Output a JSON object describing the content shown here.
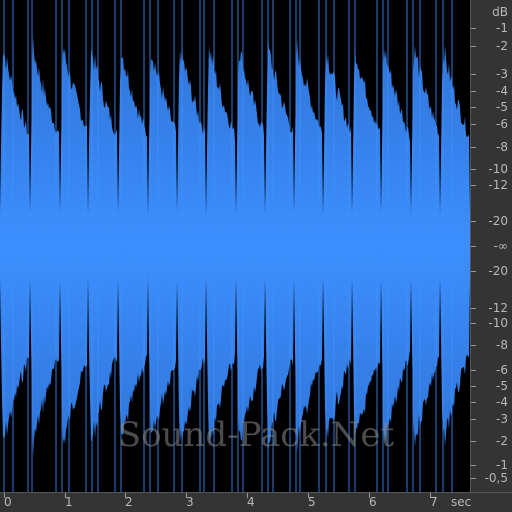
{
  "colors": {
    "waveform": "#3d8fff",
    "waveform_dark": "#2f74d6",
    "background": "#000000",
    "ruler": "#343434",
    "ruler_text": "#b8b8b8"
  },
  "db_scale": {
    "unit": "dB",
    "labels": [
      "-1",
      "-2",
      "-3",
      "-4",
      "-5",
      "-6",
      "-8",
      "-10",
      "-12",
      "-20",
      "-∞",
      "-20",
      "-12",
      "-10",
      "-8",
      "-6",
      "-5",
      "-4",
      "-3",
      "-2",
      "-1",
      "-0,5"
    ]
  },
  "time_scale": {
    "unit": "sec",
    "labels": [
      "0",
      "1",
      "2",
      "3",
      "4",
      "5",
      "6",
      "7"
    ]
  },
  "watermark": "Sound-Pack.Net"
}
